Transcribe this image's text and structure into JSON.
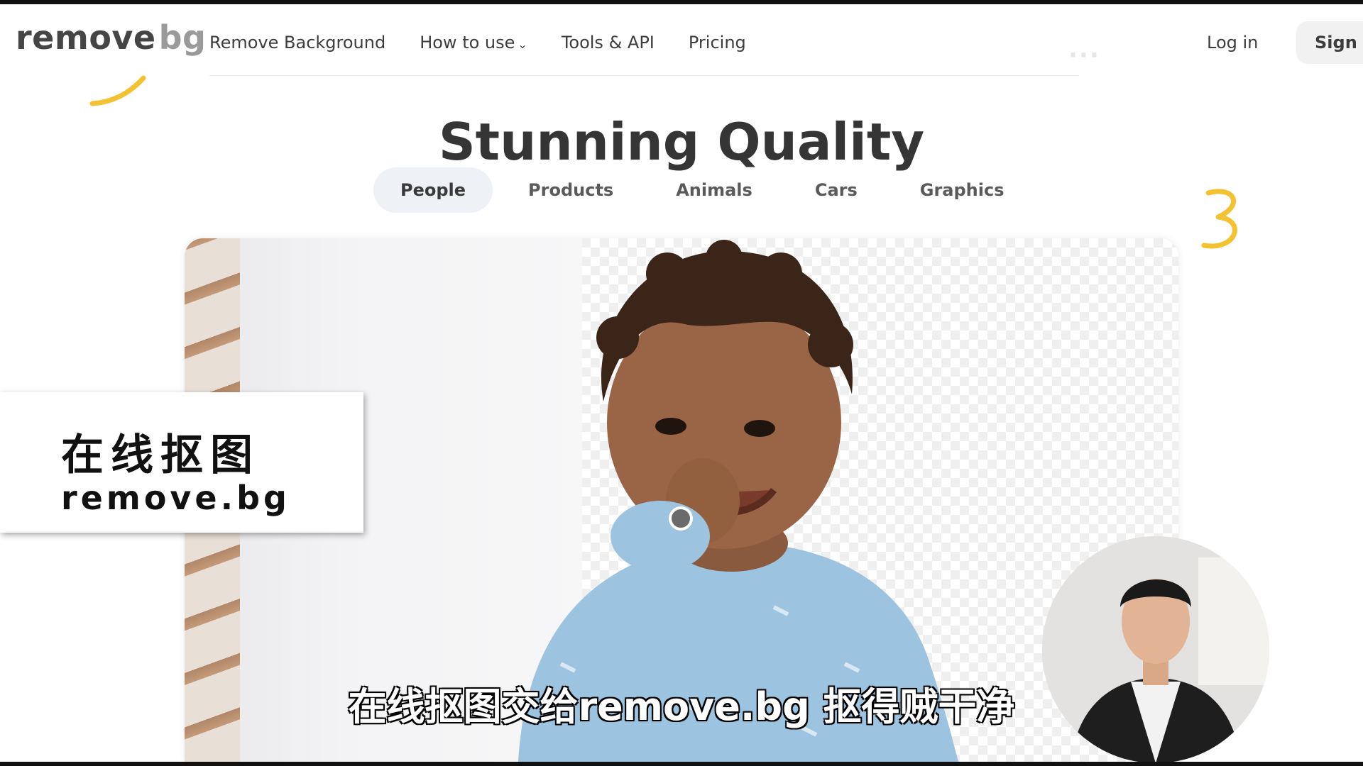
{
  "header": {
    "logo": {
      "remove": "remove",
      "bg": "bg"
    },
    "nav": [
      {
        "label": "Remove Background"
      },
      {
        "label": "How to use",
        "has_dropdown": true
      },
      {
        "label": "Tools & API"
      },
      {
        "label": "Pricing"
      }
    ],
    "login": "Log in",
    "signup": "Sign u"
  },
  "main": {
    "title": "Stunning Quality",
    "tabs": [
      {
        "label": "People",
        "active": true
      },
      {
        "label": "Products",
        "active": false
      },
      {
        "label": "Animals",
        "active": false
      },
      {
        "label": "Cars",
        "active": false
      },
      {
        "label": "Graphics",
        "active": false
      }
    ]
  },
  "overlay": {
    "card_cn": "在线抠图",
    "card_en": "remove.bg",
    "subtitle": "在线抠图交给remove.bg 抠得贼干净"
  },
  "colors": {
    "text": "#3d3d3d",
    "active_tab_bg": "#eef1f5",
    "accent_yellow": "#f2c230",
    "shirt_blue": "#9cc3df"
  }
}
